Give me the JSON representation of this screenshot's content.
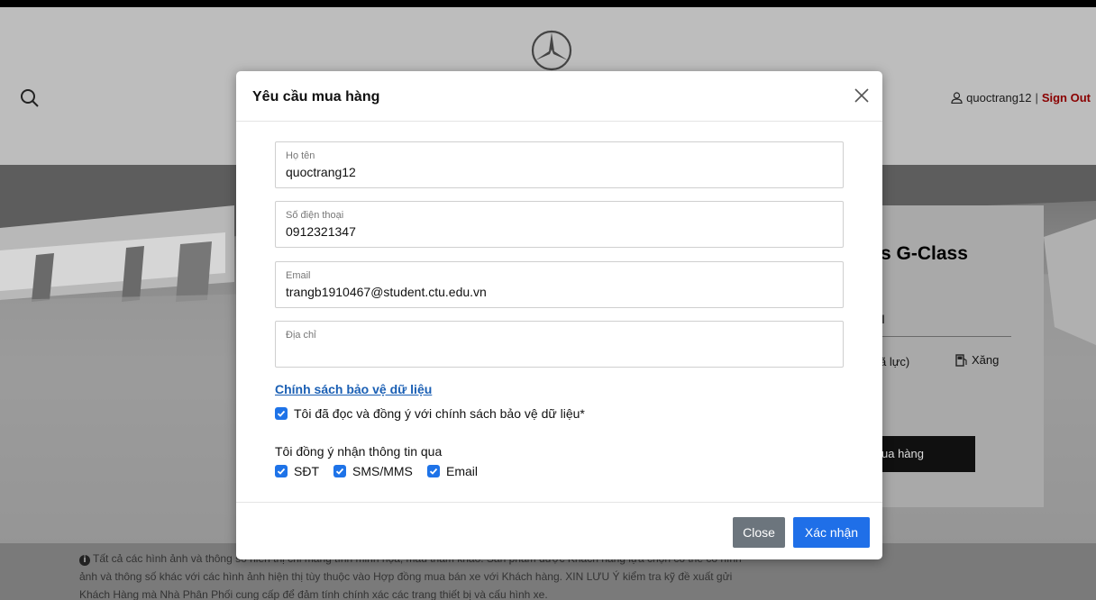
{
  "header": {
    "username": "quoctrang12",
    "separator": "|",
    "sign_out": "Sign Out"
  },
  "product": {
    "title_partial": "s G-Class",
    "mark": "I",
    "horsepower_partial": "ã lực)",
    "fuel": "Xăng",
    "buy_partial": "ua hàng"
  },
  "disclaimer": {
    "icon": "info-icon",
    "text": "Tất cả các hình ảnh và thông số hiển thị chỉ mang tính minh họa, mẫu tham khảo. Sản phẩm được Khách hàng lựa chọn có thể có hình ảnh và thông số khác với các hình ảnh hiện thị tùy thuộc vào Hợp đồng mua bán xe với Khách hàng. XIN LƯU Ý kiểm tra kỹ đề xuất gửi Khách Hàng mà Nhà Phân Phối cung cấp để đảm tính chính xác các trang thiết bị và cấu hình xe."
  },
  "modal": {
    "title": "Yêu cầu mua hàng",
    "fields": {
      "name": {
        "label": "Họ tên",
        "value": "quoctrang12"
      },
      "phone": {
        "label": "Số điện thoại",
        "value": "0912321347"
      },
      "email": {
        "label": "Email",
        "value": "trangb1910467@student.ctu.edu.vn"
      },
      "address": {
        "label": "Địa chỉ",
        "value": ""
      }
    },
    "policy_link": "Chính sách bảo vệ dữ liệu",
    "policy_agree": "Tôi đã đọc và đồng ý với chính sách bảo vệ dữ liệu*",
    "consent_label": "Tôi đồng ý nhận thông tin qua",
    "consent_options": [
      "SĐT",
      "SMS/MMS",
      "Email"
    ],
    "close_button": "Close",
    "submit_button": "Xác nhận"
  },
  "colors": {
    "primary": "#1f6fe8",
    "secondary": "#6c757d",
    "sign_out": "#8a0000",
    "link": "#1a5fb4"
  }
}
